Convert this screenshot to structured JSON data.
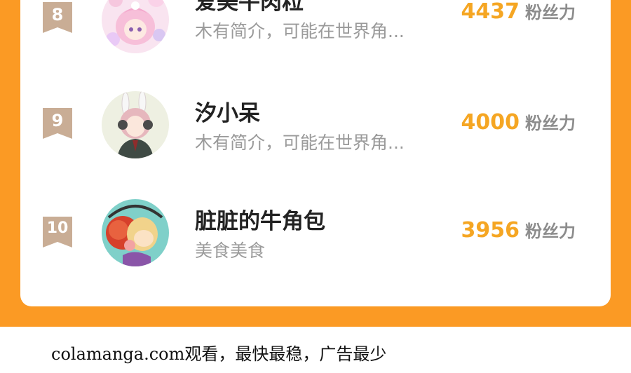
{
  "ranking": [
    {
      "rank": "8",
      "name": "爱美牛肉粒",
      "intro": "木有简介，可能在世界角...",
      "fans_count": "4437",
      "fans_unit": "粉丝力",
      "avatar_icon": "anime-girl-pink-hair-avatar-icon"
    },
    {
      "rank": "9",
      "name": "汐小呆",
      "intro": "木有简介，可能在世界角...",
      "fans_count": "4000",
      "fans_unit": "粉丝力",
      "avatar_icon": "anime-girl-bunny-ears-headphones-avatar-icon"
    },
    {
      "rank": "10",
      "name": "脏脏的牛角包",
      "intro": "美食美食",
      "fans_count": "3956",
      "fans_unit": "粉丝力",
      "avatar_icon": "cartoon-character-red-hair-avatar-icon"
    }
  ],
  "footer": {
    "text": "colamanga.com观看，最快最稳，广告最少"
  },
  "colors": {
    "background_orange": "#fb9a24",
    "fans_count": "#f5a623",
    "rank_badge": "#c9ad95"
  }
}
